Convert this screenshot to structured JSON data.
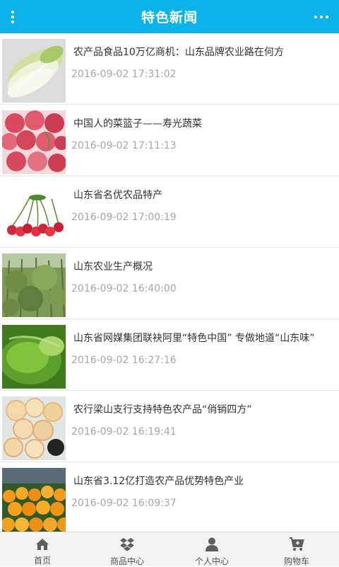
{
  "header": {
    "title": "特色新闻",
    "menu_icon": "vertical-dots-icon",
    "more_icon": "horizontal-dots-icon",
    "background": "#0bb3ea"
  },
  "news": [
    {
      "title": "农产品食品10万亿商机：山东品牌农业路在何方",
      "time": "2016-09-02 17:31:02",
      "image": "chinese-cabbage"
    },
    {
      "title": "中国人的菜篮子——寿光蔬菜",
      "time": "2016-09-02 17:11:13",
      "image": "lychees"
    },
    {
      "title": "山东省名优农品特产",
      "time": "2016-09-02 17:00:19",
      "image": "cherries"
    },
    {
      "title": "山东农业生产概况",
      "time": "2016-09-02 16:40:00",
      "image": "orchard"
    },
    {
      "title": "山东省网媒集团联袂阿里“特色中国” 专做地道“山东味”",
      "time": "2016-09-02 16:27:16",
      "image": "green-fruit"
    },
    {
      "title": "农行梁山支行支持特色农产品“俏销四方”",
      "time": "2016-09-02 16:19:41",
      "image": "sliced-fruit"
    },
    {
      "title": "山东省3.12亿打造农产品优势特色产业",
      "time": "2016-09-02 16:09:37",
      "image": "oranges"
    }
  ],
  "tabbar": [
    {
      "label": "首页",
      "icon": "home-icon"
    },
    {
      "label": "商品中心",
      "icon": "dropbox-icon"
    },
    {
      "label": "个人中心",
      "icon": "user-icon"
    },
    {
      "label": "购物车",
      "icon": "cart-icon"
    }
  ]
}
